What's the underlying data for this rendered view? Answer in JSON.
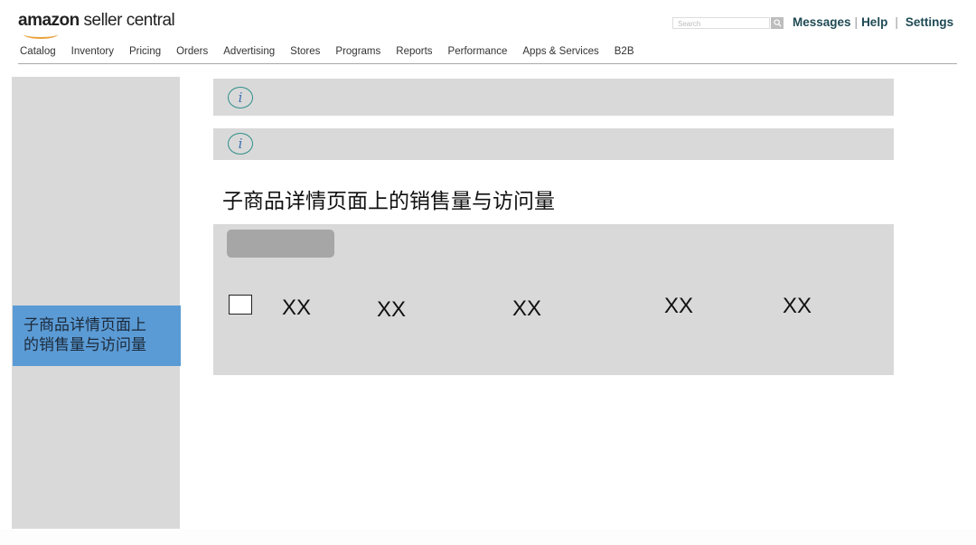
{
  "header": {
    "logo_brand": "amazon",
    "logo_suffix": " seller central",
    "search_placeholder": "Search",
    "links": [
      "Messages",
      "Help",
      "Settings"
    ]
  },
  "nav": {
    "items": [
      "Catalog",
      "Inventory",
      "Pricing",
      "Orders",
      "Advertising",
      "Stores",
      "Programs",
      "Reports",
      "Performance",
      "Apps & Services",
      "B2B"
    ]
  },
  "sidebar": {
    "active_item_line1": "子商品详情页面上",
    "active_item_line2": "的销售量与访问量",
    "active_color": "#5b9bd5"
  },
  "main": {
    "info_icon": "i",
    "title": "子商品详情页面上的销售量与访问量",
    "row": {
      "checked": false,
      "cells": [
        "XX",
        "XX",
        "XX",
        "XX",
        "XX"
      ]
    }
  }
}
